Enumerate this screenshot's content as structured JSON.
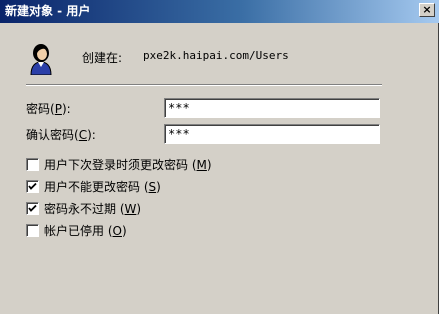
{
  "window": {
    "title": "新建对象 - 用户",
    "close_glyph": "×"
  },
  "create_in": {
    "label": "创建在:",
    "path": "pxe2k.haipai.com/Users"
  },
  "password": {
    "label": "密码",
    "hotkey": "P",
    "label_suffix": ":",
    "value": "***"
  },
  "confirm_password": {
    "label": "确认密码",
    "hotkey": "C",
    "label_suffix": ":",
    "value": "***"
  },
  "options": [
    {
      "label": "用户下次登录时须更改密码",
      "hotkey": "M",
      "checked": false
    },
    {
      "label": "用户不能更改密码",
      "hotkey": "S",
      "checked": true
    },
    {
      "label": "密码永不过期",
      "hotkey": "W",
      "checked": true
    },
    {
      "label": "帐户已停用",
      "hotkey": "O",
      "checked": false
    }
  ],
  "icons": {
    "avatar": "user-avatar-icon",
    "check": "checkmark-icon"
  }
}
